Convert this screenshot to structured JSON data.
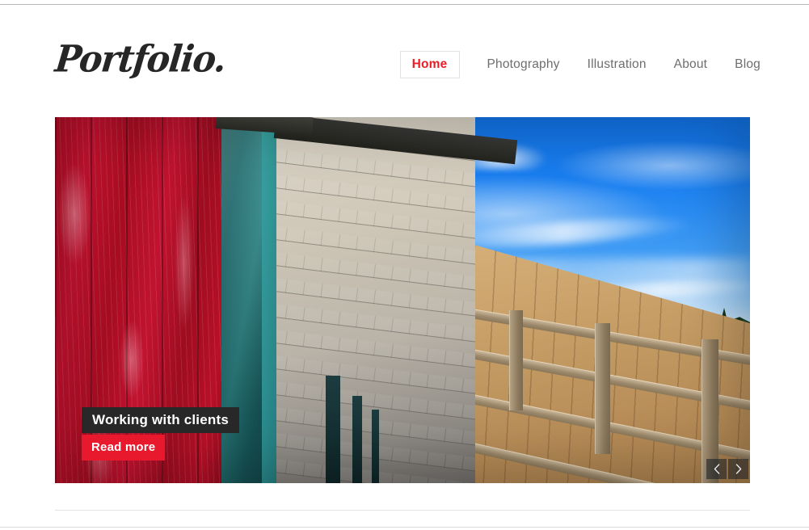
{
  "site": {
    "logo": "Portfolio."
  },
  "nav": {
    "items": [
      {
        "label": "Home",
        "active": true
      },
      {
        "label": "Photography",
        "active": false
      },
      {
        "label": "Illustration",
        "active": false
      },
      {
        "label": "About",
        "active": false
      },
      {
        "label": "Blog",
        "active": false
      }
    ]
  },
  "slider": {
    "slide": {
      "caption_title": "Working with clients",
      "read_more_label": "Read more",
      "image_alt": "Weathered red and teal wooden boathouse beside a wooden pier over blue water"
    },
    "controls": {
      "prev_label": "‹",
      "next_label": "›"
    }
  },
  "colors": {
    "accent_red": "#e8192c",
    "nav_active_red": "#ed1c24",
    "caption_bg": "#282828",
    "nav_text": "#6e6e6e",
    "logo_text": "#262626",
    "divider": "#e3e3e3",
    "top_border": "#b9b9b4"
  }
}
